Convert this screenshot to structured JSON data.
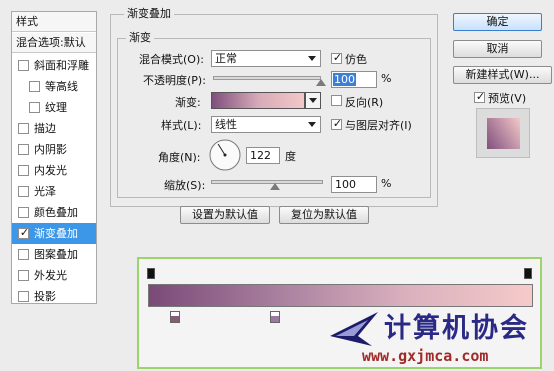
{
  "left_panel": {
    "header": "样式",
    "blend_options": "混合选项:默认",
    "items": [
      {
        "label": "斜面和浮雕",
        "checked": false
      },
      {
        "label": "等高线",
        "checked": false
      },
      {
        "label": "纹理",
        "checked": false
      },
      {
        "label": "描边",
        "checked": false
      },
      {
        "label": "内阴影",
        "checked": false
      },
      {
        "label": "内发光",
        "checked": false
      },
      {
        "label": "光泽",
        "checked": false
      },
      {
        "label": "颜色叠加",
        "checked": false
      },
      {
        "label": "渐变叠加",
        "checked": true,
        "selected": true
      },
      {
        "label": "图案叠加",
        "checked": false
      },
      {
        "label": "外发光",
        "checked": false
      },
      {
        "label": "投影",
        "checked": false
      }
    ]
  },
  "panel_title": "渐变叠加",
  "group_title": "渐变",
  "blend_mode": {
    "label": "混合模式(O):",
    "value": "正常"
  },
  "dither": {
    "label": "仿色",
    "checked": true
  },
  "opacity": {
    "label": "不透明度(P):",
    "value": "100",
    "unit": "%",
    "percent": 100
  },
  "gradient": {
    "label": "渐变:",
    "colors": [
      "#7f4f7d",
      "#d7aab8",
      "#f3c8c8"
    ]
  },
  "reverse": {
    "label": "反向(R)",
    "checked": false
  },
  "style": {
    "label": "样式(L):",
    "value": "线性"
  },
  "align_layer": {
    "label": "与图层对齐(I)",
    "checked": true
  },
  "angle": {
    "label": "角度(N):",
    "value": "122",
    "unit": "度",
    "degrees": 122
  },
  "scale": {
    "label": "缩放(S):",
    "value": "100",
    "unit": "%",
    "percent": 100
  },
  "buttons": {
    "set_default": "设置为默认值",
    "reset_default": "复位为默认值"
  },
  "right": {
    "ok": "确定",
    "cancel": "取消",
    "new_style": "新建样式(W)...",
    "preview": {
      "label": "预览(V)",
      "checked": true
    }
  },
  "editor": {
    "gradient_colors": [
      "#7a4a78",
      "#a87f9e",
      "#d9b0bd",
      "#f6caca"
    ],
    "stops": [
      {
        "location_percent": 7
      },
      {
        "location_percent": 33
      }
    ]
  },
  "watermark": {
    "text": "计算机协会",
    "url": "www.gxjmca.com"
  },
  "accent": "#3c97e8"
}
